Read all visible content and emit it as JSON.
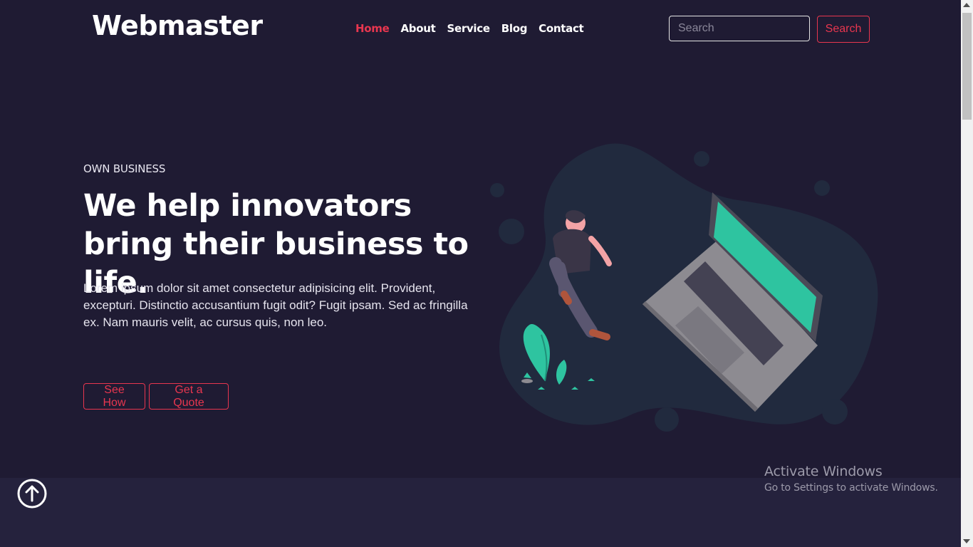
{
  "header": {
    "brand": "Webmaster",
    "nav": [
      "Home",
      "About",
      "Service",
      "Blog",
      "Contact"
    ],
    "active_nav": "Home",
    "search_placeholder": "Search",
    "search_button": "Search"
  },
  "hero": {
    "eyebrow": "OWN BUSINESS",
    "headline": "We help innovators bring their business to life.",
    "lead_line1": "Lorem ipsum dolor sit amet consectetur adipisicing elit. Provident, excepturi. Distinctio accusantium fugit odit? Fugit ipsam. Sed ac fringilla",
    "lead_line2": "ex. Nam mauris velit, ac cursus quis, non leo.",
    "btn_primary": "See How",
    "btn_secondary": "Get a Quote",
    "illustration_icon": "person-with-laptop-illustration"
  },
  "scroll_top_icon": "arrow-up-circle-icon",
  "watermark": {
    "title": "Activate Windows",
    "subtitle": "Go to Settings to activate Windows."
  },
  "colors": {
    "background": "#1f1b33",
    "band": "#25223d",
    "accent": "#e8364f",
    "blob": "#212a3e",
    "laptop_screen": "#2ec4a0"
  }
}
